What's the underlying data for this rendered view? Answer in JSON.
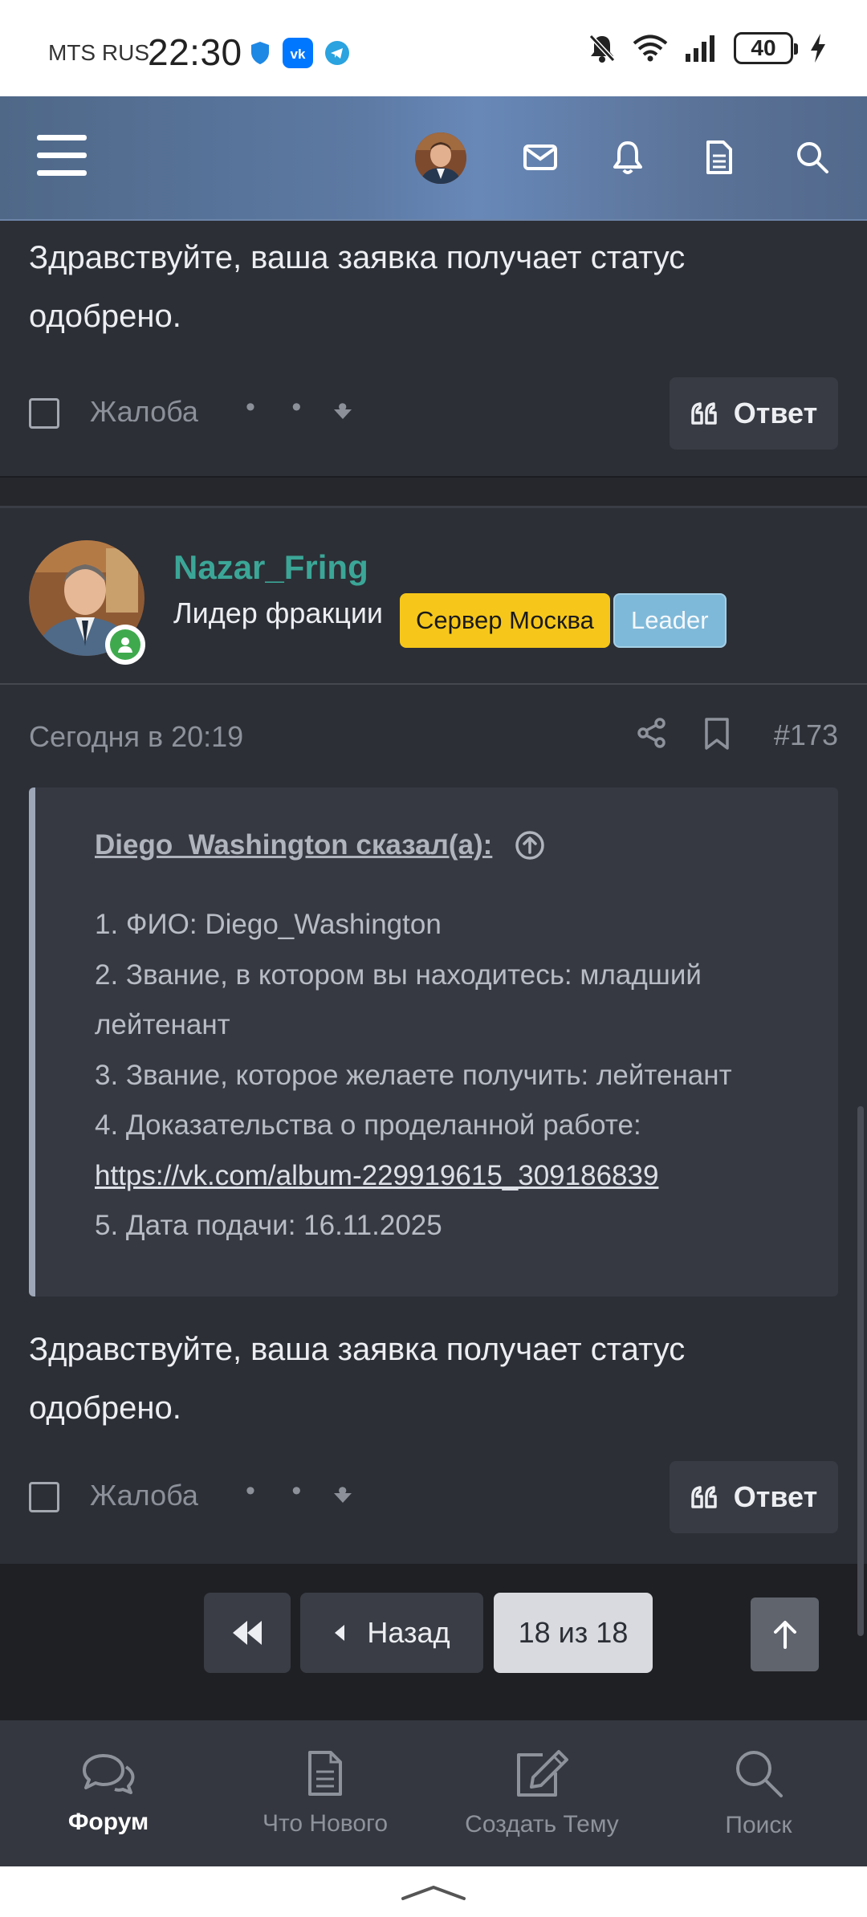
{
  "status_bar": {
    "carrier": "MTS RUS",
    "time": "22:30",
    "battery": "40"
  },
  "post_prev": {
    "text": "Здравствуйте, ваша заявка получает статус одобрено.",
    "complaint_label": "Жалоба",
    "more_dots": "• • •",
    "reply_label": "Ответ"
  },
  "author": {
    "username": "Nazar_Fring",
    "user_title": "Лидер фракции",
    "badge_server": "Сервер Москва",
    "badge_role": "Leader"
  },
  "post": {
    "date": "Сегодня в 20:19",
    "number": "#173",
    "quote": {
      "author": "Diego_Washington сказал(а):",
      "line1": "1. ФИО: Diego_Washington",
      "line2": "2. Звание, в котором вы находитесь: младший лейтенант",
      "line3": "3. Звание, которое желаете получить: лейтенант",
      "line4": "4. Доказательства о проделанной работе:",
      "link": "https://vk.com/album-229919615_309186839",
      "line5": "5. Дата подачи: 16.11.2025"
    },
    "text": "Здравствуйте, ваша заявка получает статус одобрено.",
    "complaint_label": "Жалоба",
    "more_dots": "• • •",
    "reply_label": "Ответ"
  },
  "pagination": {
    "prev_label": "Назад",
    "current": "18 из 18"
  },
  "bottom_nav": {
    "items": [
      {
        "label": "Форум",
        "icon": "forum-icon",
        "active": true
      },
      {
        "label": "Что Нового",
        "icon": "document-icon",
        "active": false
      },
      {
        "label": "Создать Тему",
        "icon": "edit-icon",
        "active": false
      },
      {
        "label": "Поиск",
        "icon": "search-icon",
        "active": false
      }
    ]
  },
  "colors": {
    "username": "#3ba697",
    "badge_server": "#f6c71a",
    "badge_leader": "#7fb9d9",
    "online": "#3eaa4d"
  }
}
